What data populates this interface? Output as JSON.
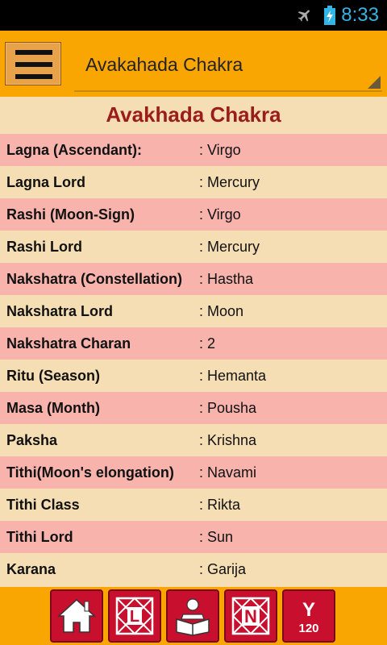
{
  "status_bar": {
    "time": "8:33",
    "icons": [
      "airplane-icon",
      "battery-charging-icon"
    ],
    "accent_color": "#33b5e5"
  },
  "action_bar": {
    "menu_icon": "hamburger-menu-icon",
    "spinner_selected": "Avakahada Chakra"
  },
  "page": {
    "title": "Avakhada Chakra",
    "title_color": "#9b1c1c"
  },
  "rows": [
    {
      "label": "Lagna (Ascendant):",
      "value": ": Virgo"
    },
    {
      "label": "Lagna Lord",
      "value": ": Mercury"
    },
    {
      "label": "Rashi (Moon-Sign)",
      "value": ": Virgo"
    },
    {
      "label": "Rashi Lord",
      "value": ": Mercury"
    },
    {
      "label": "Nakshatra (Constellation)",
      "value": ": Hastha"
    },
    {
      "label": "Nakshatra Lord",
      "value": ": Moon"
    },
    {
      "label": "Nakshatra Charan",
      "value": ": 2"
    },
    {
      "label": "Ritu (Season)",
      "value": ": Hemanta"
    },
    {
      "label": "Masa (Month)",
      "value": ": Pousha"
    },
    {
      "label": "Paksha",
      "value": ": Krishna"
    },
    {
      "label": "Tithi(Moon's elongation)",
      "value": ": Navami"
    },
    {
      "label": "Tithi Class",
      "value": ": Rikta"
    },
    {
      "label": "Tithi Lord",
      "value": ": Sun"
    },
    {
      "label": "Karana",
      "value": ": Garija"
    }
  ],
  "bottom_nav": {
    "buttons": [
      "home-icon",
      "lagna-chart-icon",
      "horoscope-book-icon",
      "navamsa-chart-icon",
      "yearly-120-icon"
    ],
    "yearly_label_letter": "Y",
    "yearly_label_number": "120",
    "button_color": "#c8102e"
  }
}
